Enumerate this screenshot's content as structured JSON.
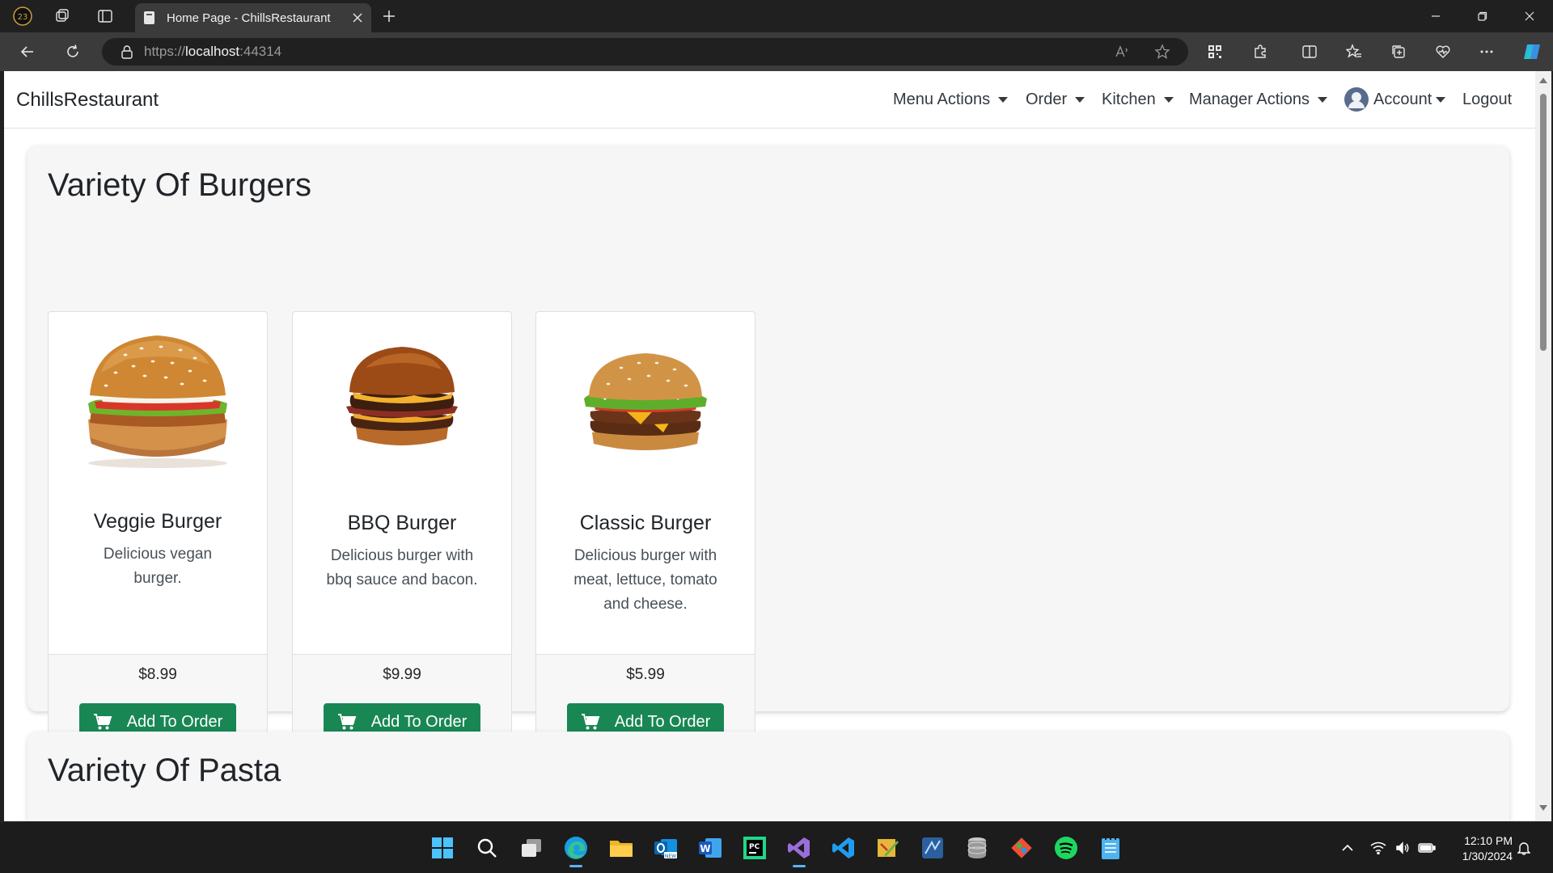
{
  "browser": {
    "tab_title": "Home Page - ChillsRestaurant",
    "url_scheme": "https://",
    "url_host": "localhost",
    "url_port": ":44314"
  },
  "site": {
    "brand": "ChillsRestaurant",
    "nav": {
      "menu_actions": "Menu Actions",
      "order": "Order",
      "kitchen": "Kitchen",
      "manager_actions": "Manager Actions",
      "account": "Account",
      "logout": "Logout"
    }
  },
  "sections": [
    {
      "title": "Variety Of Burgers",
      "items": [
        {
          "name": "Veggie Burger",
          "description": "Delicious vegan burger.",
          "price": "$8.99",
          "button": "Add To Order"
        },
        {
          "name": "BBQ Burger",
          "description": "Delicious burger with bbq sauce and bacon.",
          "price": "$9.99",
          "button": "Add To Order"
        },
        {
          "name": "Classic Burger",
          "description": "Delicious burger with meat, lettuce, tomato and cheese.",
          "price": "$5.99",
          "button": "Add To Order"
        }
      ]
    },
    {
      "title": "Variety Of Pasta"
    }
  ],
  "taskbar": {
    "time": "12:10 PM",
    "date": "1/30/2024",
    "apps": [
      "start-icon",
      "search-icon",
      "task-view-icon",
      "edge-icon",
      "file-explorer-icon",
      "outlook-icon",
      "word-icon",
      "pycharm-icon",
      "visual-studio-icon",
      "vscode-icon",
      "notes-app-icon",
      "app-icon",
      "database-icon",
      "git-icon",
      "spotify-icon",
      "notepad-icon"
    ]
  },
  "colors": {
    "accent_button": "#198754",
    "section_bg": "#f6f6f6",
    "chrome_dark": "#202020"
  }
}
